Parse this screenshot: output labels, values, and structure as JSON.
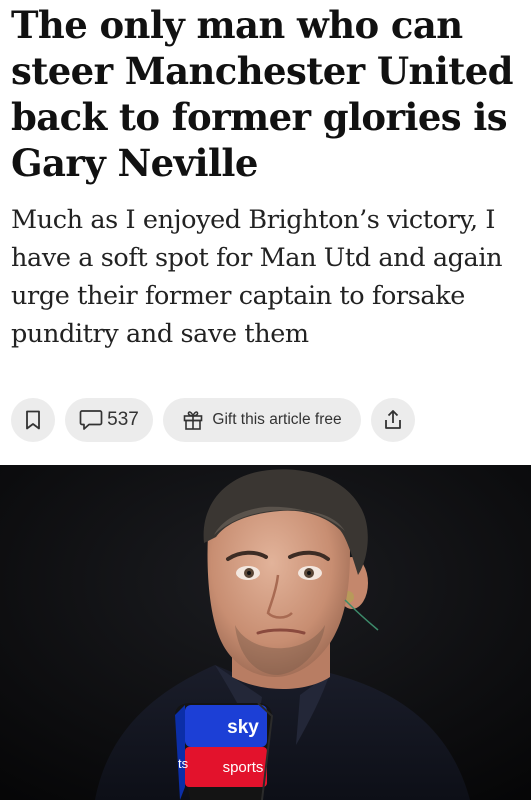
{
  "article": {
    "headline": "The only man who can steer Manchester United back to former glories is Gary Neville",
    "standfirst": "Much as I enjoyed Brighton’s victory, I have a soft spot for Man Utd and again urge their former captain to forsake punditry and save them"
  },
  "actions": {
    "bookmark_icon": "bookmark-icon",
    "comment_icon": "comment-icon",
    "comment_count": "537",
    "gift_icon": "gift-icon",
    "gift_label": "Gift this article free",
    "share_icon": "share-icon"
  },
  "photo": {
    "mic_logo_top": "sky",
    "mic_logo_bottom": "sports",
    "mic_cube_partial": "ts",
    "colors": {
      "background": "#0b0b0c",
      "mic_blue": "#1c3fd6",
      "mic_red": "#e3122c"
    }
  }
}
